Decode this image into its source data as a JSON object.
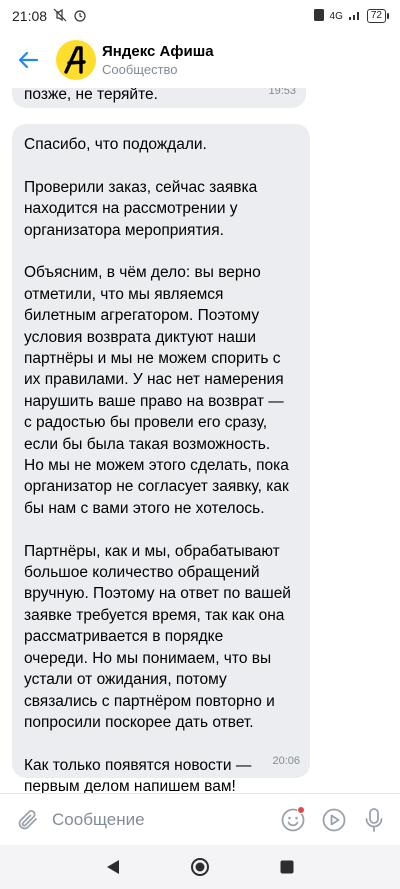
{
  "status": {
    "time": "21:08",
    "signal": "4G",
    "battery": "72"
  },
  "header": {
    "title": "Яндекс Афиша",
    "subtitle": "Сообщество",
    "avatar_letter": "A",
    "accent": "#ffdd2d",
    "back_color": "#2688eb"
  },
  "messages": [
    {
      "text": "позже, не теряйте.",
      "time": "19:53"
    },
    {
      "paragraphs": [
        "Спасибо, что подождали.",
        "Проверили заказ, сейчас заявка\nнаходится на рассмотрении у\nорганизатора мероприятия.",
        "Объясним, в чём дело: вы верно\nотметили, что мы являемся\nбилетным агрегатором. Поэтому\nусловия возврата диктуют наши\nпартнёры и мы не можем спорить с\nих правилами. У нас нет намерения\nнарушить ваше право на возврат —\nс радостью бы провели его сразу,\nесли бы была такая возможность.\nНо мы не можем этого сделать, пока\nорганизатор не согласует заявку, как\nбы нам с вами этого не хотелось.",
        "Партнёры, как и мы, обрабатывают\nбольшое количество обращений\nвручную. Поэтому на ответ по вашей\nзаявке требуется время, так как она\nрассматривается в порядке\nочереди. Но мы понимаем, что вы\nустали от ожидания, потому\nсвязались с партнёром повторно и\nпопросили поскорее дать ответ.",
        "Как только появятся новости —\nпервым делом напишем вам!"
      ],
      "time": "20:06"
    }
  ],
  "composer": {
    "placeholder": "Сообщение"
  },
  "icons": {
    "back": "arrow-left-icon",
    "attach": "paperclip-icon",
    "sticker": "smiley-icon",
    "play": "play-icon",
    "mic": "microphone-icon",
    "nav_back": "triangle-back-icon",
    "nav_home": "circle-home-icon",
    "nav_recents": "square-recents-icon"
  }
}
